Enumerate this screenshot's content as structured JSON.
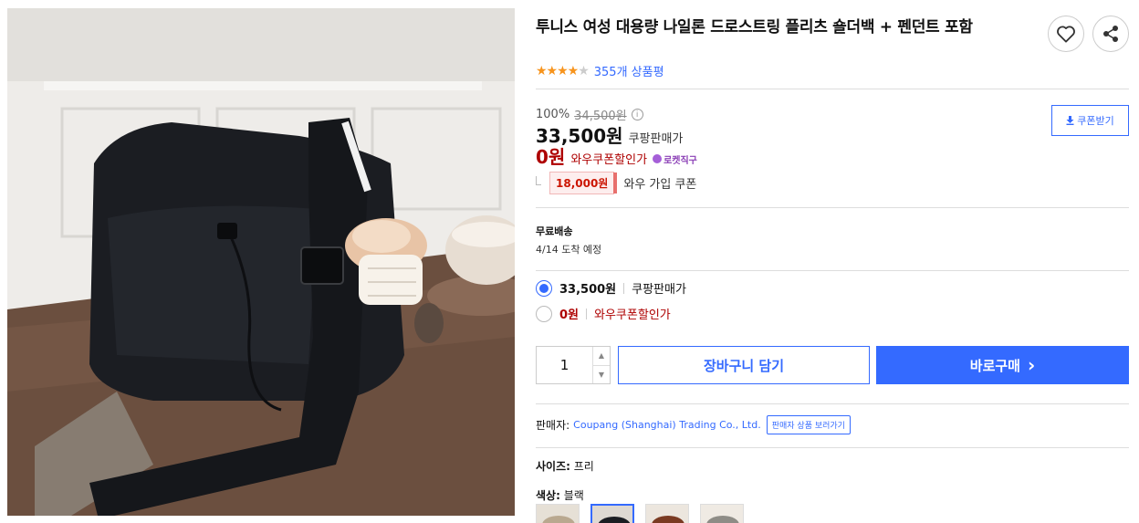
{
  "product": {
    "title": "투니스 여성 대용량 나일론 드로스트링 플리츠 숄더백 + 펜던트 포함",
    "rating_count": "355개 상품평",
    "rating_value": 4.5,
    "icons": {
      "favorite": "heart-icon",
      "share": "share-icon"
    }
  },
  "price": {
    "discount_rate": "100%",
    "original_price": "34,500원",
    "info_symbol": "i",
    "sale_price": "33,500원",
    "sale_label": "쿠팡판매가",
    "wow_price": "0원",
    "wow_label": "와우쿠폰할인가",
    "rocket_label": "로켓직구",
    "coupon_button": "쿠폰받기",
    "wow_coupon_amount": "18,000원",
    "wow_coupon_label": "와우 가입 쿠폰"
  },
  "shipping": {
    "title": "무료배송",
    "arrival": "4/14 도착 예정"
  },
  "options": [
    {
      "price": "33,500원",
      "label": "쿠팡판매가",
      "selected": true
    },
    {
      "price": "0원",
      "label": "와우쿠폰할인가",
      "selected": false
    }
  ],
  "purchase": {
    "quantity": "1",
    "cart_label": "장바구니 담기",
    "buy_label": "바로구매",
    "buy_arrow": "›"
  },
  "seller": {
    "prefix": "판매자:",
    "name": "Coupang (Shanghai) Trading Co., Ltd.",
    "button": "판매자 상품 보러가기"
  },
  "size": {
    "label": "사이즈:",
    "value": "프리"
  },
  "color": {
    "label": "색상:",
    "value": "블랙"
  },
  "color_swatches": [
    "beige",
    "black",
    "brown",
    "gray"
  ],
  "colors": {
    "accent": "#346aff",
    "wow_red": "#ae0000",
    "star": "#f7941d"
  }
}
